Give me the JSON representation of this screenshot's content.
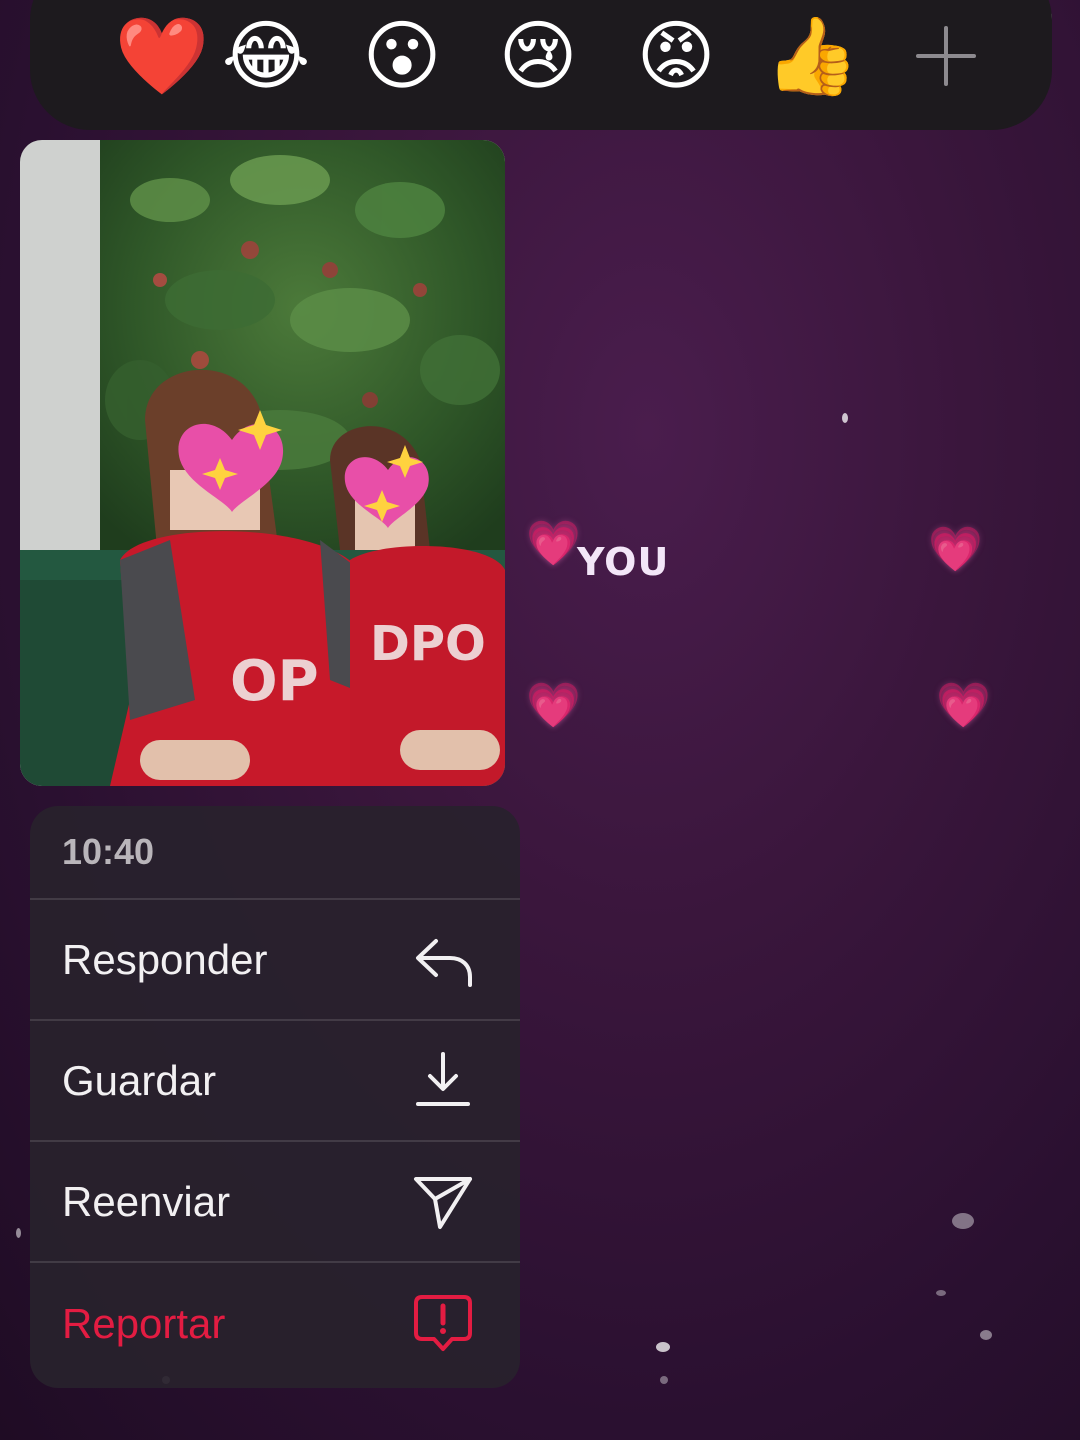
{
  "reactions": [
    {
      "emoji": "❤️",
      "icon": "red-heart-icon"
    },
    {
      "emoji": "😂",
      "icon": "tears-of-joy-icon"
    },
    {
      "emoji": "😮",
      "icon": "surprised-face-icon"
    },
    {
      "emoji": "😢",
      "icon": "crying-face-icon"
    },
    {
      "emoji": "😡",
      "icon": "angry-face-icon"
    },
    {
      "emoji": "👍",
      "icon": "thumbs-up-icon"
    }
  ],
  "more_reactions": {
    "label": "+",
    "icon": "plus-icon"
  },
  "photo": {
    "icon": "photo-message"
  },
  "sticker": {
    "text": "YOU",
    "heart": "💗",
    "heart_color": "#f05ab4"
  },
  "menu": {
    "time": "10:40",
    "items": [
      {
        "label": "Responder",
        "icon": "reply-arrow-icon"
      },
      {
        "label": "Guardar",
        "icon": "download-icon"
      },
      {
        "label": "Reenviar",
        "icon": "send-icon"
      },
      {
        "label": "Reportar",
        "icon": "report-alert-icon",
        "color": "#e31c42"
      }
    ]
  },
  "colors": {
    "background": "#3a163c",
    "menu_bg": "#28222c",
    "danger": "#e31c42"
  }
}
